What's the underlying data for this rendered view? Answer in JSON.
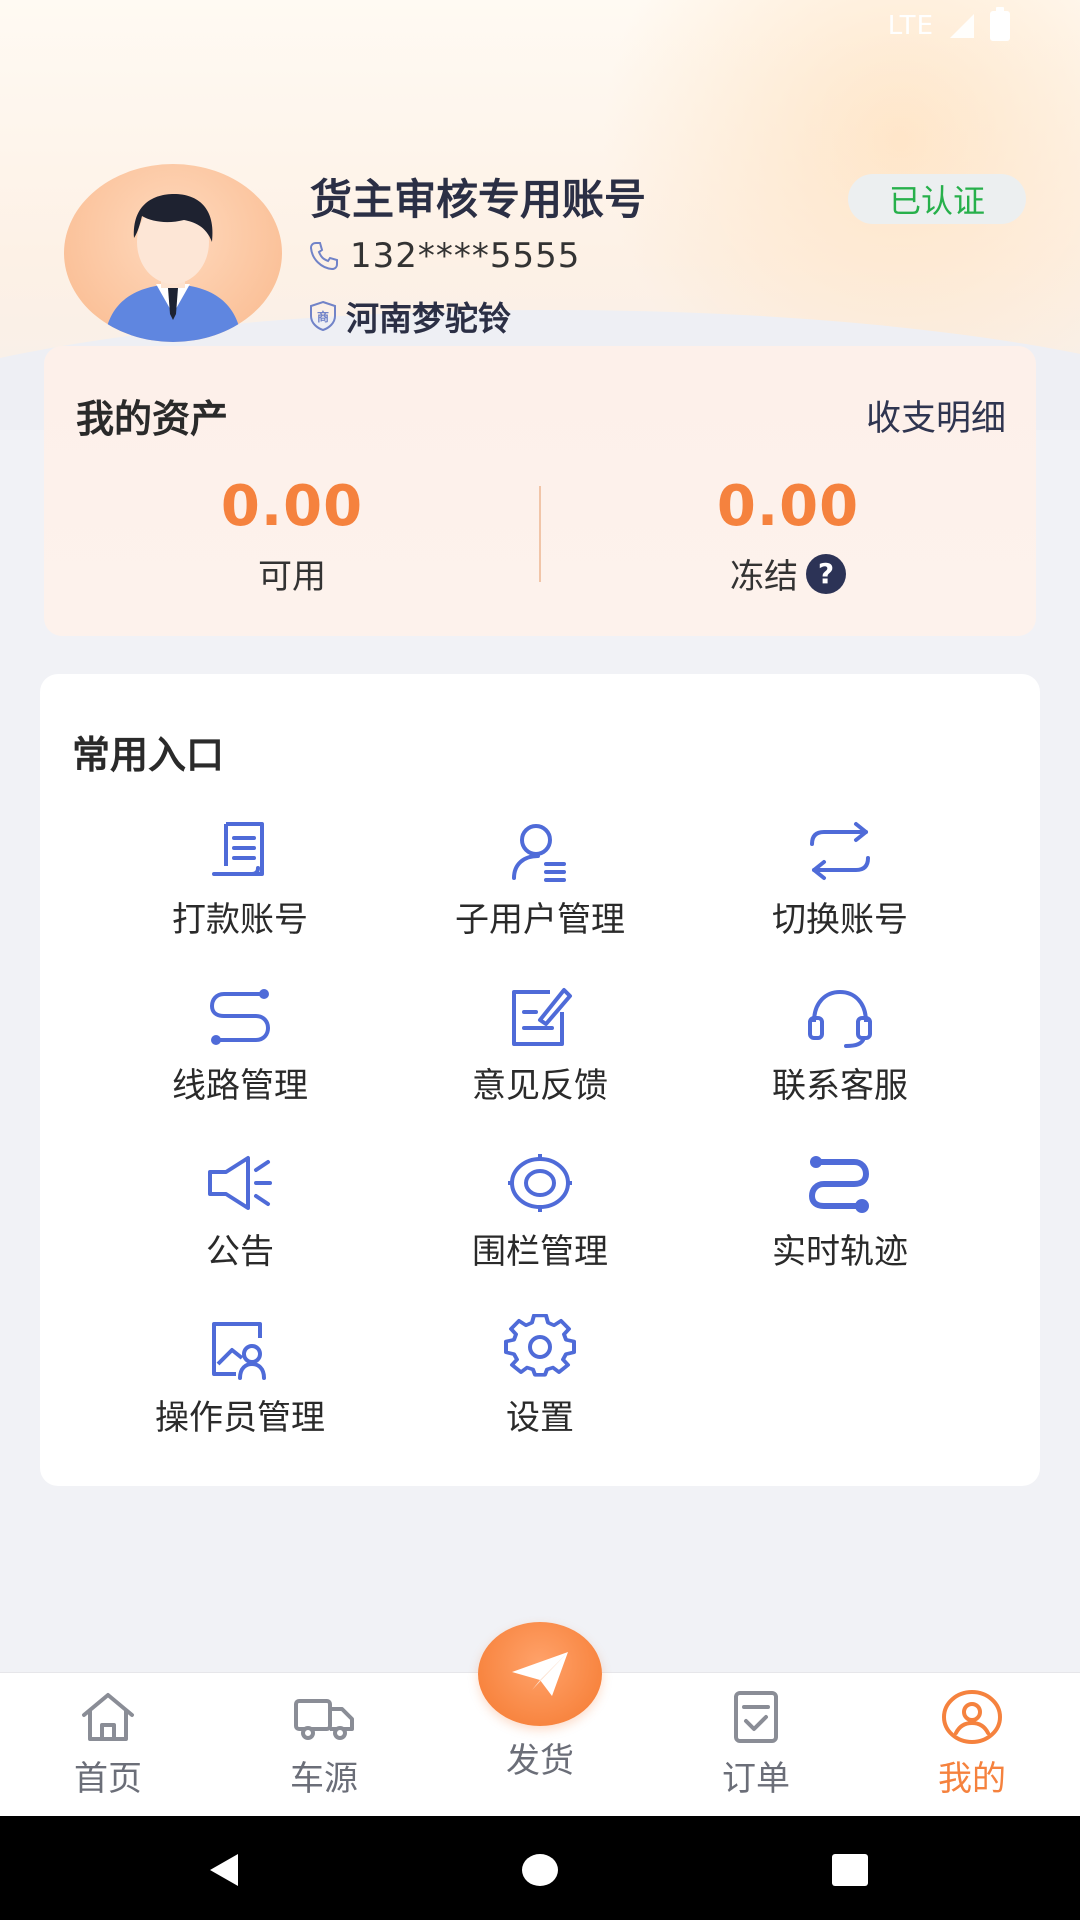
{
  "status_bar": {
    "network": "LTE"
  },
  "profile": {
    "name": "货主审核专用账号",
    "verified_badge": "已认证",
    "phone": "132****5555",
    "company": "河南梦驼铃"
  },
  "assets": {
    "title": "我的资产",
    "detail_link": "收支明细",
    "available": {
      "value": "0.00",
      "label": "可用"
    },
    "frozen": {
      "value": "0.00",
      "label": "冻结"
    }
  },
  "entries": {
    "title": "常用入口",
    "items": [
      {
        "label": "打款账号",
        "icon": "receipt-icon"
      },
      {
        "label": "子用户管理",
        "icon": "sub-user-icon"
      },
      {
        "label": "切换账号",
        "icon": "switch-arrows-icon"
      },
      {
        "label": "线路管理",
        "icon": "route-icon"
      },
      {
        "label": "意见反馈",
        "icon": "edit-note-icon"
      },
      {
        "label": "联系客服",
        "icon": "headset-icon"
      },
      {
        "label": "公告",
        "icon": "megaphone-icon"
      },
      {
        "label": "围栏管理",
        "icon": "target-icon"
      },
      {
        "label": "实时轨迹",
        "icon": "track-icon"
      },
      {
        "label": "操作员管理",
        "icon": "operator-image-icon"
      },
      {
        "label": "设置",
        "icon": "gear-icon"
      }
    ]
  },
  "tabs": [
    {
      "label": "首页",
      "icon": "home-icon",
      "active": false
    },
    {
      "label": "车源",
      "icon": "truck-icon",
      "active": false
    },
    {
      "label": "发货",
      "icon": "paper-plane-icon",
      "active": false
    },
    {
      "label": "订单",
      "icon": "order-icon",
      "active": false
    },
    {
      "label": "我的",
      "icon": "user-circle-icon",
      "active": true
    }
  ],
  "colors": {
    "accent": "#f5823e",
    "icon_blue": "#4f6bd8",
    "verified_green": "#27b04b",
    "text_dark": "#2b2f45"
  }
}
